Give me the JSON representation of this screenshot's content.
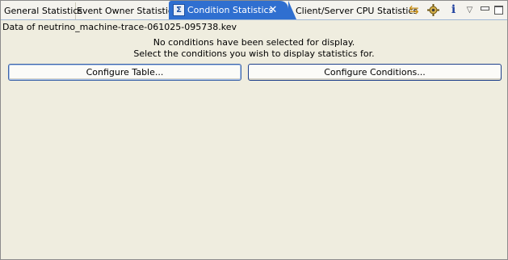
{
  "tabs": [
    {
      "label": "General Statistics"
    },
    {
      "label": "Event Owner Statistics"
    },
    {
      "label": "Condition Statistics",
      "active": true,
      "icon": "sigma-icon",
      "icon_glyph": "Σ"
    },
    {
      "label": "Client/Server CPU Statistics"
    }
  ],
  "tab_close_glyph": "✕",
  "toolbar": {
    "sync_icon": "⇆",
    "info_glyph": "i",
    "menu_glyph": "▽"
  },
  "content": {
    "data_file": "Data of neutrino_machine-trace-061025-095738.kev",
    "message_line1": "No conditions have been selected for display.",
    "message_line2": "Select the conditions you wish to display statistics for.",
    "configure_table_label": "Configure Table...",
    "configure_conditions_label": "Configure Conditions..."
  },
  "colors": {
    "active_tab": "#2f6fd0",
    "panel_background": "#efeddf",
    "button_border": "#1d3f8a"
  }
}
